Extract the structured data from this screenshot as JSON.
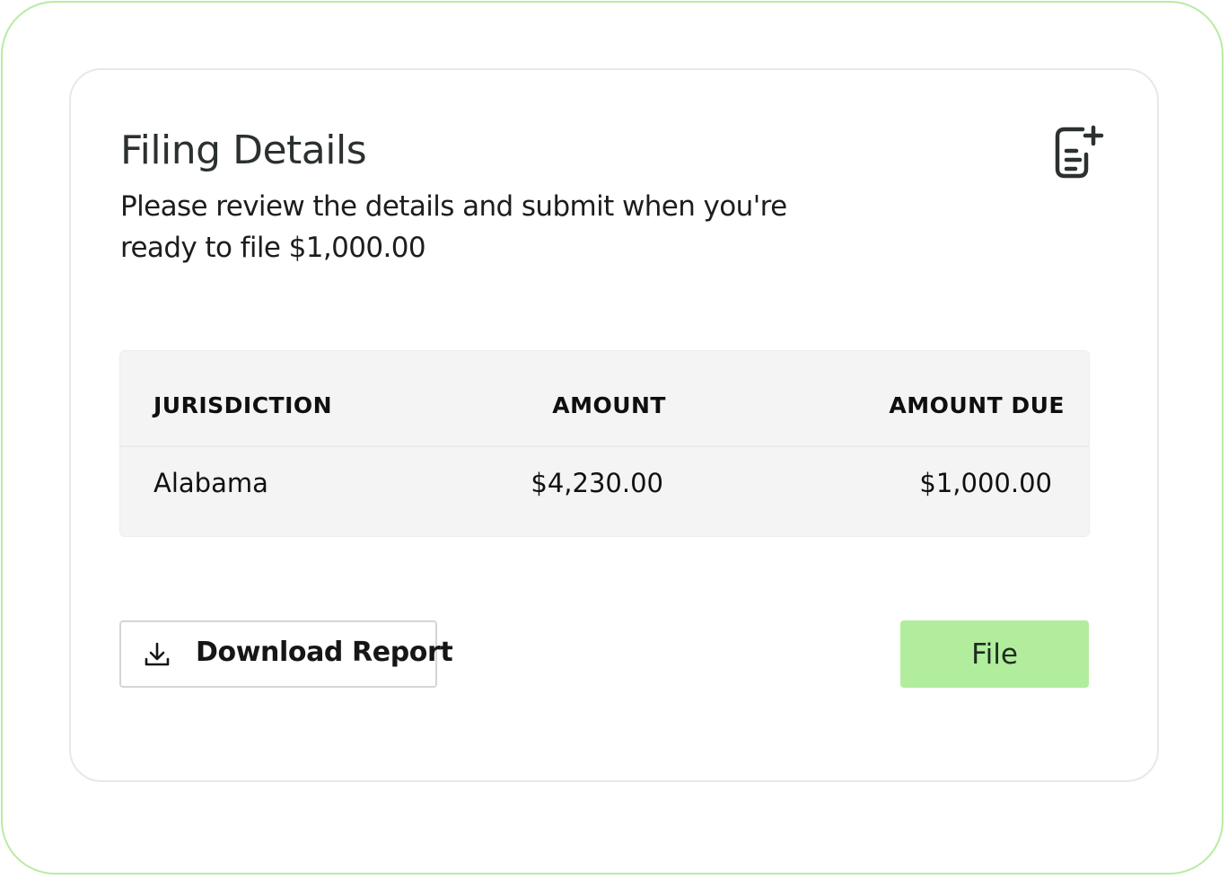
{
  "card": {
    "title": "Filing Details",
    "subtitle": "Please review the details and submit when you're ready to file $1,000.00",
    "header_icon": "document-add-icon"
  },
  "table": {
    "columns": [
      "JURISDICTION",
      "AMOUNT",
      "AMOUNT DUE"
    ],
    "rows": [
      {
        "jurisdiction": "Alabama",
        "amount": "$4,230.00",
        "amount_due": "$1,000.00"
      }
    ]
  },
  "actions": {
    "download_label": "Download Report",
    "download_icon": "download-icon",
    "file_label": "File"
  },
  "colors": {
    "frame_border": "#b8eba2",
    "primary_button": "#b1ed9d",
    "table_bg": "#f4f4f4"
  }
}
